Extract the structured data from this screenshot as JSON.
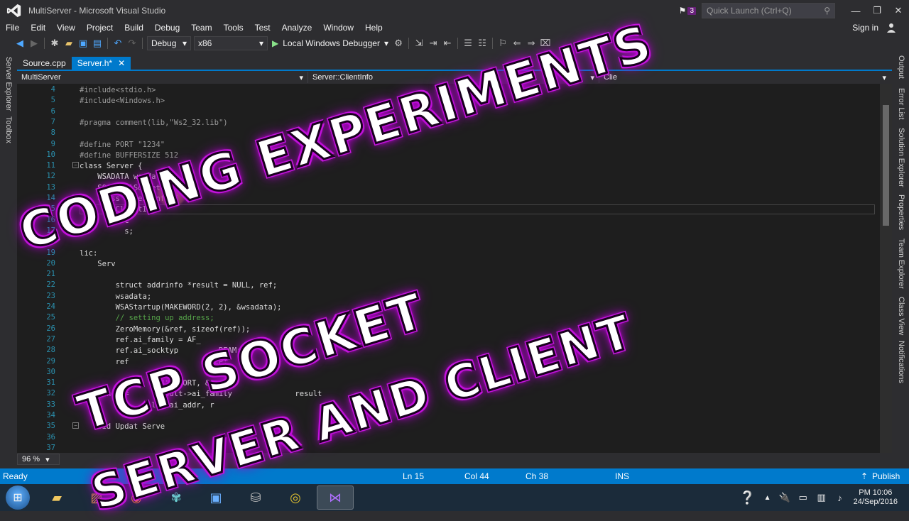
{
  "window": {
    "title": "MultiServer - Microsoft Visual Studio",
    "notification_count": "3",
    "quick_launch_placeholder": "Quick Launch (Ctrl+Q)"
  },
  "menu": [
    "File",
    "Edit",
    "View",
    "Project",
    "Build",
    "Debug",
    "Team",
    "Tools",
    "Test",
    "Analyze",
    "Window",
    "Help"
  ],
  "signin": "Sign in",
  "toolbar": {
    "config": "Debug",
    "platform": "x86",
    "run_label": "Local Windows Debugger"
  },
  "left_rail": [
    "Server Explorer",
    "Toolbox"
  ],
  "right_rail": [
    "Output",
    "Error List",
    "Solution Explorer",
    "Properties",
    "Team Explorer",
    "Class View",
    "Notifications"
  ],
  "tabs": [
    {
      "label": "Source.cpp",
      "active": false
    },
    {
      "label": "Server.h*",
      "active": true
    }
  ],
  "nav": {
    "project": "MultiServer",
    "scope": "Server::ClientInfo",
    "member": "Clie"
  },
  "code": [
    {
      "n": "4",
      "t": "#include<stdio.h>"
    },
    {
      "n": "5",
      "t": "#include<Windows.h>"
    },
    {
      "n": "6",
      "t": ""
    },
    {
      "n": "7",
      "t": "#pragma comment(lib,\"Ws2_32.lib\")"
    },
    {
      "n": "8",
      "t": ""
    },
    {
      "n": "9",
      "t": "#define PORT \"1234\""
    },
    {
      "n": "10",
      "t": "#define BUFFERSIZE 512"
    },
    {
      "n": "11",
      "t": "class Server {"
    },
    {
      "n": "12",
      "t": "    WSADATA wsadata;"
    },
    {
      "n": "13",
      "t": "    SOCKET lSocket;"
    },
    {
      "n": "14",
      "t": "    class ClientInfo {"
    },
    {
      "n": "15",
      "t": "        ClientInfo"
    },
    {
      "n": "16",
      "t": "        SOC"
    },
    {
      "n": "17",
      "t": "          s;"
    },
    {
      "n": "18",
      "t": ""
    },
    {
      "n": "19",
      "t": "lic:"
    },
    {
      "n": "20",
      "t": "    Serv"
    },
    {
      "n": "21",
      "t": ""
    },
    {
      "n": "22",
      "t": "        struct addrinfo *result = NULL, ref;"
    },
    {
      "n": "23",
      "t": "        wsadata;"
    },
    {
      "n": "24",
      "t": "        WSAStartup(MAKEWORD(2, 2), &wsadata);"
    },
    {
      "n": "25",
      "t": "        // setting up address;"
    },
    {
      "n": "26",
      "t": "        ZeroMemory(&ref, sizeof(ref));"
    },
    {
      "n": "27",
      "t": "        ref.ai_family = AF_"
    },
    {
      "n": "28",
      "t": "        ref.ai_socktyp         REAM;"
    },
    {
      "n": "29",
      "t": "        ref                  TCP;"
    },
    {
      "n": "30",
      "t": "                     ;"
    },
    {
      "n": "31",
      "t": "                .34\", PORT, &"
    },
    {
      "n": "32",
      "t": "      ket =      result->ai_family              result"
    },
    {
      "n": "33",
      "t": "                lt->ai_addr, r"
    },
    {
      "n": "34",
      "t": ""
    },
    {
      "n": "35",
      "t": "    oid Updat Serve"
    },
    {
      "n": "36",
      "t": ""
    },
    {
      "n": "37",
      "t": ""
    }
  ],
  "zoom": "96 %",
  "status": {
    "ready": "Ready",
    "ln": "Ln 15",
    "col": "Col 44",
    "ch": "Ch 38",
    "ins": "INS",
    "publish": "Publish"
  },
  "clock": {
    "time": "PM 10:06",
    "date": "24/Sep/2016"
  },
  "overlay": {
    "line1": "CODING EXPERIMENTS",
    "line2": "TCP SOCKET",
    "line3": "SERVER AND CLIENT"
  },
  "colors": {
    "accent": "#007acc",
    "editor_bg": "#1e1e1e",
    "chrome": "#2d2d30",
    "glow": "#d020e8"
  }
}
